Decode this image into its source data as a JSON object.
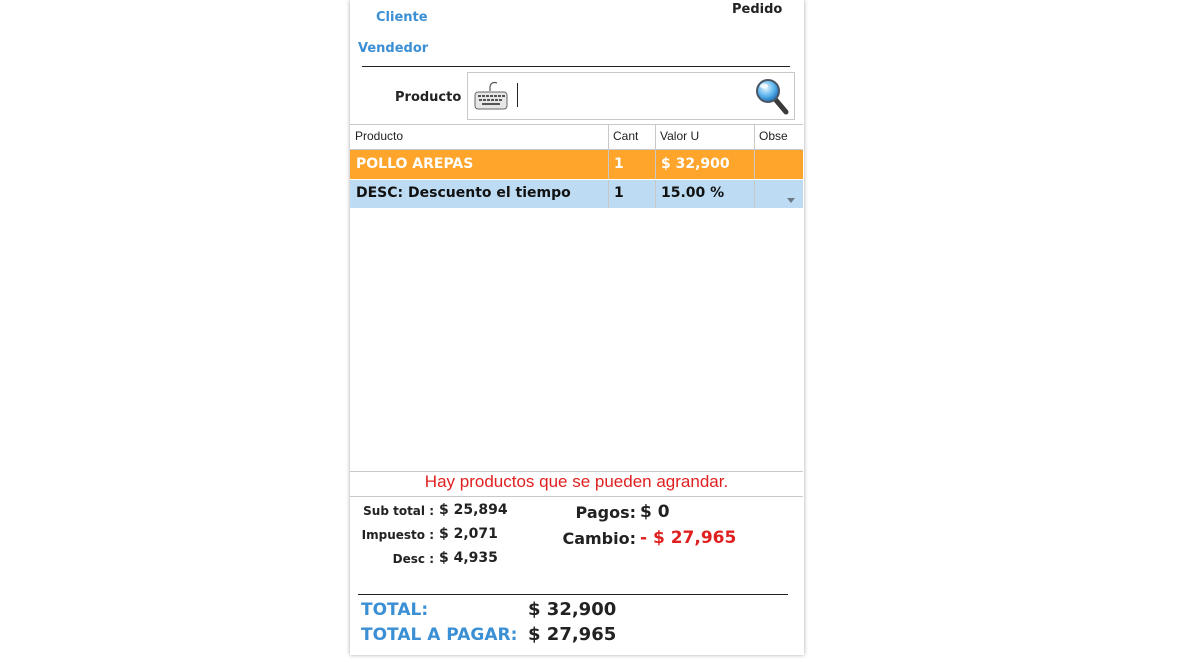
{
  "header": {
    "cliente_label": "Cliente",
    "pedido_label": "Pedido",
    "vendedor_label": "Vendedor"
  },
  "search": {
    "label": "Producto",
    "value": ""
  },
  "grid": {
    "columns": [
      "Producto",
      "Cant",
      "Valor U",
      "Obse"
    ],
    "rows": [
      {
        "producto": "POLLO AREPAS",
        "cant": "1",
        "valor": "$ 32,900",
        "obse": ""
      },
      {
        "producto": "DESC: Descuento el tiempo",
        "cant": "1",
        "valor": "15.00 %",
        "obse": ""
      }
    ]
  },
  "warning": "Hay productos que se pueden agrandar.",
  "summary": {
    "subtotal_label": "Sub total :",
    "subtotal_value": "$ 25,894",
    "impuesto_label": "Impuesto :",
    "impuesto_value": "$ 2,071",
    "desc_label": "Desc :",
    "desc_value": "$ 4,935",
    "pagos_label": "Pagos:",
    "pagos_value": "$ 0",
    "cambio_label": "Cambio:",
    "cambio_value": "- $ 27,965",
    "total_label": "TOTAL:",
    "total_value": "$ 32,900",
    "total_pagar_label": "TOTAL A PAGAR:",
    "total_pagar_value": "$ 27,965"
  },
  "colors": {
    "accent_blue": "#3b8fd4",
    "row_selected": "#ffa52c",
    "row_discount": "#bddcf3",
    "warning_red": "#e02020"
  },
  "icons": [
    "keyboard-icon",
    "magnifier-icon",
    "dropdown-arrow-icon"
  ]
}
